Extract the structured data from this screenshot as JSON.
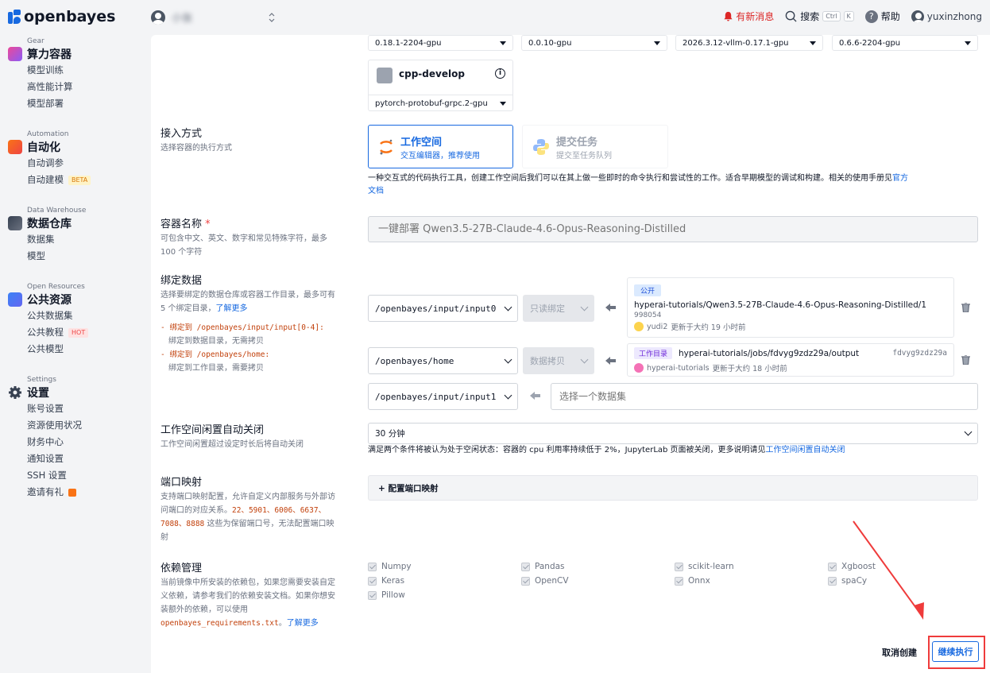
{
  "topbar": {
    "brand": "openbayes",
    "username": "小张",
    "news": "有新消息",
    "search": "搜索",
    "search_kbd_ctrl": "Ctrl",
    "search_kbd_k": "K",
    "help": "帮助",
    "account": "yuxinzhong"
  },
  "sidebar": {
    "sections": [
      {
        "en": "Gear",
        "title": "算力容器",
        "items": [
          "模型训练",
          "高性能计算",
          "模型部署"
        ]
      },
      {
        "en": "Automation",
        "title": "自动化",
        "items": [
          "自动调参",
          "自动建模"
        ],
        "badge": "BETA"
      },
      {
        "en": "Data Warehouse",
        "title": "数据仓库",
        "items": [
          "数据集",
          "模型"
        ]
      },
      {
        "en": "Open Resources",
        "title": "公共资源",
        "items": [
          "公共数据集",
          "公共教程",
          "公共模型"
        ],
        "badge": "HOT"
      },
      {
        "en": "Settings",
        "title": "设置",
        "items": [
          "账号设置",
          "资源使用状况",
          "财务中心",
          "通知设置",
          "SSH 设置",
          "邀请有礼"
        ]
      }
    ]
  },
  "images": {
    "selects": [
      "0.18.1-2204-gpu",
      "0.0.10-gpu",
      "2026.3.12-vllm-0.17.1-gpu",
      "0.6.6-2204-gpu"
    ],
    "cpp_title": "cpp-develop",
    "cpp_version": "pytorch-protobuf-grpc.2-gpu"
  },
  "access": {
    "label": "接入方式",
    "desc": "选择容器的执行方式",
    "workspace_title": "工作空间",
    "workspace_sub": "交互编辑器，推荐使用",
    "task_title": "提交任务",
    "task_sub": "提交至任务队列",
    "note": "一种交互式的代码执行工具，创建工作空间后我们可以在其上做一些即时的命令执行和尝试性的工作。适合早期模型的调试和构建。相关的使用手册见",
    "note_link1": "官方",
    "note_link2": "文档"
  },
  "name": {
    "label": "容器名称",
    "required": "*",
    "desc1": "可包含中文、英文、数字和常见特殊字符，最多",
    "desc2": "100 个字符",
    "placeholder": "一键部署 Qwen3.5-27B-Claude-4.6-Opus-Reasoning-Distilled"
  },
  "bind": {
    "label": "绑定数据",
    "desc1": "选择要绑定的数据仓库或容器工作目录，最多可有",
    "desc2": "5 个绑定目录，",
    "learn_more": "了解更多",
    "rule1_prefix": "- 绑定到 /openbayes/input/input[0-4]:",
    "rule1_desc": "绑定到数据目录，无需拷贝",
    "rule2_prefix": "- 绑定到 /openbayes/home:",
    "rule2_desc": "绑定到工作目录，需要拷贝",
    "rows": [
      {
        "path": "/openbayes/input/input0",
        "mode": "只读绑定"
      },
      {
        "path": "/openbayes/home",
        "mode": "数据拷贝"
      },
      {
        "path": "/openbayes/input/input1",
        "placeholder": "选择一个数据集"
      }
    ],
    "card1": {
      "tag": "公开",
      "path": "hyperai-tutorials/Qwen3.5-27B-Claude-4.6-Opus-Reasoning-Distilled/1",
      "id": "998054",
      "user": "yudi2",
      "time": "更新于大约 19 小时前"
    },
    "card2": {
      "tag": "工作目录",
      "path": "hyperai-tutorials/jobs/fdvyg9zdz29a/output",
      "id": "fdvyg9zdz29a",
      "user": "hyperai-tutorials",
      "time": "更新于大约 18 小时前"
    }
  },
  "idle": {
    "label": "工作空间闲置自动关闭",
    "desc": "工作空间闲置超过设定时长后将自动关闭",
    "value": "30 分钟",
    "note": "满足两个条件将被认为处于空闲状态：容器的 cpu 利用率持续低于 2%，JupyterLab 页面被关闭，更多说明请见",
    "note_link": "工作空间闲置自动关闭"
  },
  "ports": {
    "label": "端口映射",
    "desc1": "支持端口映射配置，允许自定义内部服务与外部访",
    "desc2": "问端口的对应关系。",
    "reserved1": "22、5901、6006、6637、",
    "reserved2": "7088、8888",
    "desc3": "这些为保留端口号，无法配置端口映",
    "desc4": "射",
    "button": "+ 配置端口映射"
  },
  "deps": {
    "label": "依赖管理",
    "desc1": "当前镜像中所安装的依赖包，如果您需要安装自定",
    "desc2": "义依赖，请参考我们的依赖安装文档。如果你想安",
    "desc3": "装额外的依赖，可以使用",
    "file": "openbayes_requirements.txt",
    "learn_more": "了解更多",
    "packages": [
      "Numpy",
      "Pandas",
      "scikit-learn",
      "Xgboost",
      "Keras",
      "OpenCV",
      "Onnx",
      "spaCy",
      "Pillow"
    ]
  },
  "footer": {
    "cancel": "取消创建",
    "continue": "继续执行"
  },
  "colors": {
    "brand": "#1769e0",
    "alert": "#dc2626",
    "annotation": "#ef3b3b"
  }
}
